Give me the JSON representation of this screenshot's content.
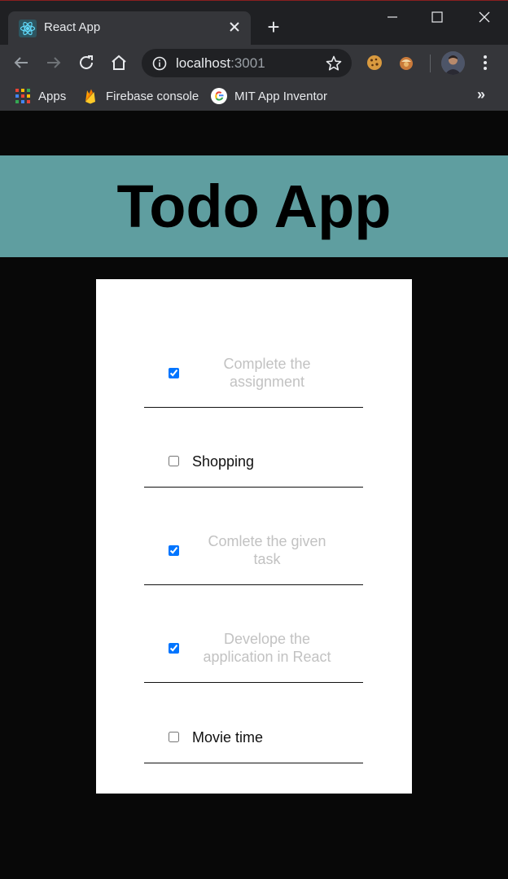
{
  "browser": {
    "tab_title": "React App",
    "new_tab_symbol": "+",
    "url_host": "localhost",
    "url_port": ":3001",
    "bookmarks": [
      {
        "label": "Apps",
        "icon": "apps-grid-icon"
      },
      {
        "label": "Firebase console",
        "icon": "firebase-icon"
      },
      {
        "label": "MIT App Inventor",
        "icon": "google-icon"
      }
    ],
    "bookmarks_more": "»"
  },
  "app": {
    "title": "Todo App",
    "todos": [
      {
        "text": "Complete the assignment",
        "completed": true
      },
      {
        "text": "Shopping",
        "completed": false
      },
      {
        "text": "Comlete the given task",
        "completed": true
      },
      {
        "text": "Develope the application in React",
        "completed": true
      },
      {
        "text": "Movie time",
        "completed": false
      }
    ]
  },
  "colors": {
    "header_bg": "#5f9ea0",
    "page_bg": "#080808",
    "completed_text": "#c2c2c2"
  }
}
